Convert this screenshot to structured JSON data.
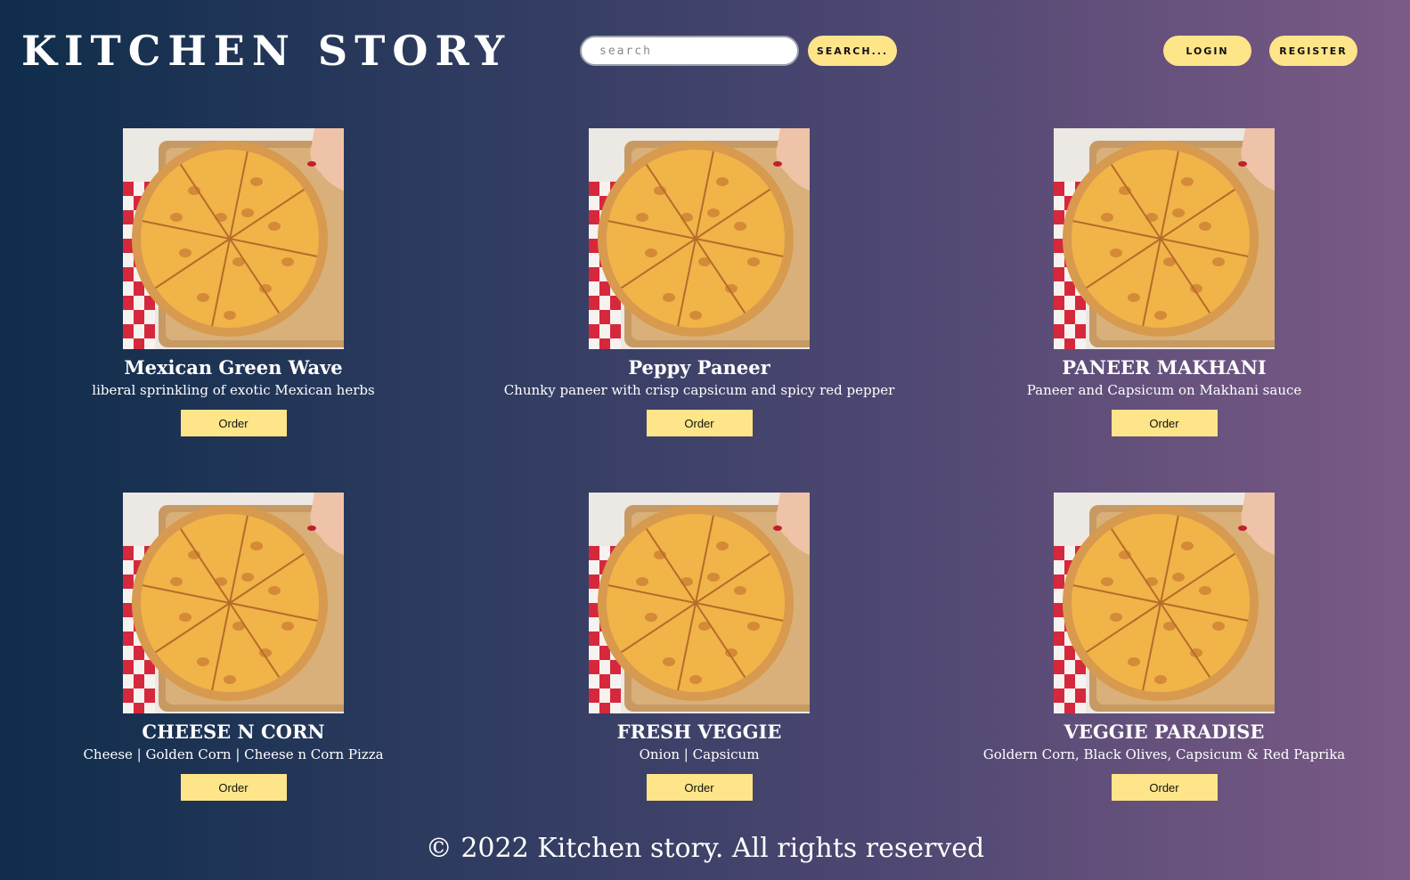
{
  "header": {
    "brand": "KITCHEN STORY",
    "search_placeholder": "search",
    "search_button": "SEARCH...",
    "login_button": "LOGIN",
    "register_button": "REGISTER"
  },
  "products": [
    {
      "title": "Mexican Green Wave",
      "description": "liberal sprinkling of exotic Mexican herbs",
      "order_label": "Order"
    },
    {
      "title": "Peppy Paneer",
      "description": "Chunky paneer with crisp capsicum and spicy red pepper",
      "order_label": "Order"
    },
    {
      "title": "PANEER MAKHANI",
      "description": "Paneer and Capsicum on Makhani sauce",
      "order_label": "Order"
    },
    {
      "title": "CHEESE N CORN",
      "description": "Cheese | Golden Corn | Cheese n Corn Pizza",
      "order_label": "Order"
    },
    {
      "title": "FRESH VEGGIE",
      "description": "Onion | Capsicum",
      "order_label": "Order"
    },
    {
      "title": "VEGGIE PARADISE",
      "description": "Goldern Corn, Black Olives, Capsicum & Red Paprika",
      "order_label": "Order"
    }
  ],
  "footer": {
    "text": "© 2022 Kitchen story. All rights reserved"
  },
  "colors": {
    "accent": "#ffe58a",
    "gradient_start": "#0f2d4b",
    "gradient_end": "#7b5a86"
  },
  "icons": {
    "product_image": "pizza-image"
  }
}
